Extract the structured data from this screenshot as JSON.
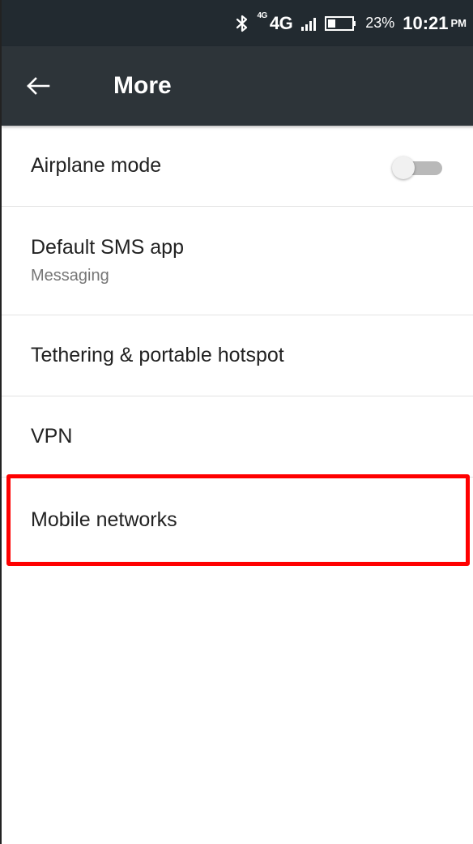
{
  "status_bar": {
    "bluetooth_icon": "bluetooth-icon",
    "network_small": "4G",
    "network_type": "4G",
    "signal_icon": "signal-bars-icon",
    "battery_icon": "battery-icon",
    "battery_percent": "23%",
    "time": "10:21",
    "ampm": "PM"
  },
  "app_bar": {
    "back_icon": "arrow-back-icon",
    "title": "More",
    "background": "#2d3439"
  },
  "settings": {
    "items": [
      {
        "title": "Airplane mode",
        "toggle": false
      },
      {
        "title": "Default SMS app",
        "subtitle": "Messaging"
      },
      {
        "title": "Tethering & portable hotspot"
      },
      {
        "title": "VPN"
      },
      {
        "title": "Mobile networks",
        "highlighted": true
      }
    ]
  },
  "highlight_color": "#ff0000"
}
